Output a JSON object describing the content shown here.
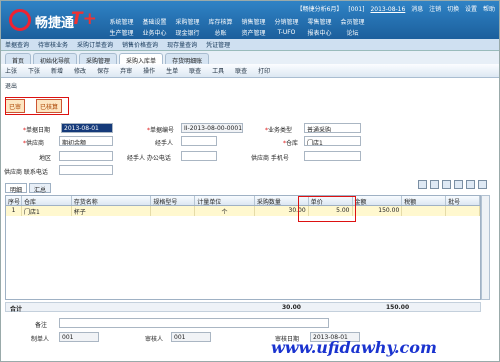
{
  "app": {
    "logo_text": "畅捷通",
    "logo_suffix": "T+",
    "window_title": "【畅捷分析6月】",
    "account": "[001]",
    "date": "2013-08-16",
    "status": "消息",
    "links": [
      "注销",
      "切换",
      "设置",
      "帮助"
    ]
  },
  "menu": {
    "row1": [
      "系统管理",
      "基础设置",
      "采购管理",
      "库存核算",
      "销售管理",
      "分销管理",
      "零售管理",
      "会员管理"
    ],
    "row2": [
      "生产管理",
      "业务中心",
      "现金银行",
      "总账",
      "资产管理",
      "T-UFO",
      "报表中心",
      "论坛"
    ]
  },
  "tabs_row1": [
    "单据查询",
    "待审核业务",
    "采购订单查询",
    "销售价格查询",
    "现存量查询",
    "凭证管理"
  ],
  "tabs_row2": [
    "首页",
    "初始化导航",
    "采购管理",
    "采购入库单",
    "存货明细账"
  ],
  "tabs_row2_active": 3,
  "toolbar": [
    "上张",
    "下张",
    "新增",
    "修改",
    "保存",
    "弃审",
    "操作",
    "生单",
    "联查",
    "工具",
    "联查",
    "打印"
  ],
  "exit_label": "退出",
  "badges": [
    "已审",
    "已核算"
  ],
  "form": {
    "doc_date_label": "单据日期",
    "doc_date": "2013-08-01",
    "doc_no_label": "单据编号",
    "doc_no": "II-2013-08-00-0001",
    "biz_type_label": "业务类型",
    "biz_type": "普通采购",
    "supplier_label": "供应商",
    "supplier": "期初余额",
    "handler_label": "经手人",
    "handler": "",
    "warehouse_label": "仓库",
    "warehouse": "门店1",
    "region_label": "地区",
    "region": "",
    "office_phone_label": "经手人 办公电话",
    "office_phone": "",
    "supplier_mobile_label": "供应商 手机号",
    "supplier_mobile": "",
    "supplier_contact_label": "供应商 联系电话",
    "supplier_contact": ""
  },
  "detail_tabs": [
    "明细",
    "汇总"
  ],
  "grid": {
    "headers": [
      "序号",
      "仓库",
      "存货名称",
      "规格型号",
      "计量单位",
      "采购数量",
      "单价",
      "金额",
      "税额",
      "批号"
    ],
    "rows": [
      [
        "1",
        "门店1",
        "杯子",
        "",
        "个",
        "30.00",
        "5.00",
        "150.00",
        "",
        ""
      ]
    ]
  },
  "summary": {
    "label": "合计",
    "qty": "30.00",
    "amount": "150.00"
  },
  "footer": {
    "remark_label": "备注",
    "maker_label": "制单人",
    "maker": "001",
    "auditor_label": "审核人",
    "auditor": "001",
    "audit_date_label": "审核日期",
    "audit_date": "2013-08-01"
  },
  "watermark": "www.ufidawhy.com"
}
